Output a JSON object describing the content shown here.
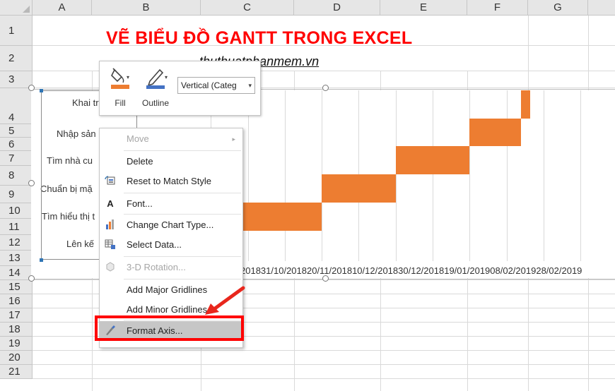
{
  "sheet": {
    "columns": [
      "A",
      "B",
      "C",
      "D",
      "E",
      "F",
      "G"
    ],
    "rows": [
      "1",
      "2",
      "3",
      "4",
      "5",
      "6",
      "7",
      "8",
      "9",
      "10",
      "11",
      "12",
      "13",
      "14",
      "15",
      "16",
      "17",
      "18",
      "19",
      "20",
      "21"
    ],
    "title": "VẼ BIỂU ĐỒ GANTT TRONG EXCEL",
    "subtitle": "thuthuatphanmem.vn"
  },
  "chart": {
    "categories_visible": [
      "Khai tr",
      "Nhập sản",
      "Tìm nhà cu",
      "Chuẩn bị mặ",
      "Tìm hiểu thị t",
      "Lên kế"
    ],
    "x_axis_labels": "201831/10/201820/11/201810/12/201830/12/201819/01/201908/02/201928/02/2019",
    "bar_color": "#ed7d31"
  },
  "chart_data": {
    "type": "bar",
    "orientation": "horizontal-gantt",
    "x_tick_labels": [
      "…2018",
      "31/10/2018",
      "20/11/2018",
      "10/12/2018",
      "30/12/2018",
      "19/01/2019",
      "08/02/2019",
      "28/02/2019"
    ]
  },
  "mini_toolbar": {
    "fill_label": "Fill",
    "outline_label": "Outline",
    "element_select_value": "Vertical (Categ"
  },
  "context_menu": {
    "items": [
      {
        "label": "Move",
        "icon": "",
        "disabled": true,
        "submenu": true
      },
      {
        "label": "Delete",
        "icon": ""
      },
      {
        "label": "Reset to Match Style",
        "icon": "reset-style-icon"
      },
      {
        "label": "Font...",
        "icon": "font-icon"
      },
      {
        "label": "Change Chart Type...",
        "icon": "chart-type-icon"
      },
      {
        "label": "Select Data...",
        "icon": "select-data-icon"
      },
      {
        "label": "3-D Rotation...",
        "icon": "rotation-3d-icon",
        "disabled": true
      },
      {
        "label": "Add Major Gridlines",
        "icon": ""
      },
      {
        "label": "Add Minor Gridlines",
        "icon": ""
      },
      {
        "label": "Format Axis...",
        "icon": "format-axis-icon",
        "selected": true
      }
    ]
  },
  "colors": {
    "title_red": "#ff0000",
    "highlight_red": "#ff0000",
    "bar_orange": "#ed7d31"
  }
}
